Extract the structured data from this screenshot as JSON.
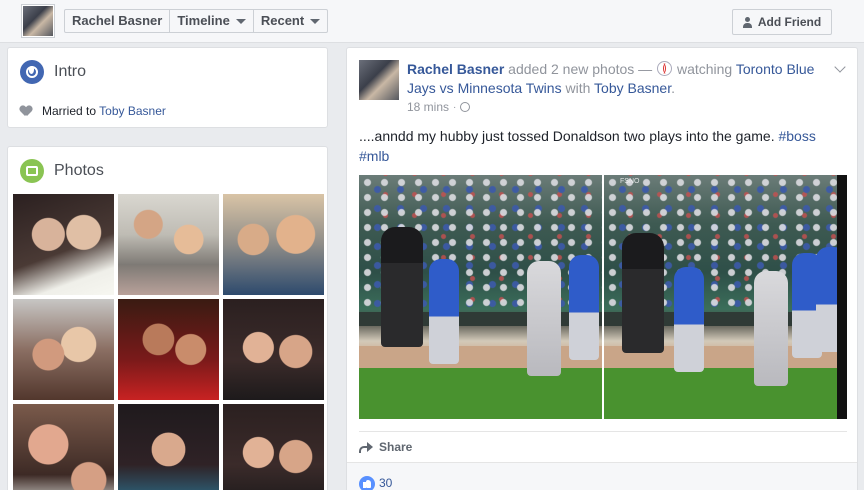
{
  "topbar": {
    "crumbs": [
      {
        "label": "Rachel Basner"
      },
      {
        "label": "Timeline"
      },
      {
        "label": "Recent"
      }
    ],
    "add_friend_label": "Add Friend"
  },
  "intro": {
    "title": "Intro",
    "married_prefix": "Married to",
    "spouse": "Toby Basner"
  },
  "photos": {
    "title": "Photos",
    "count": 9
  },
  "post": {
    "author": "Rachel Basner",
    "action": "added 2 new photos —",
    "activity": "watching",
    "event": "Toronto Blue Jays vs Minnesota Twins",
    "with_word": "with",
    "with_person": "Toby Basner",
    "end_punct": ".",
    "time": "18 mins",
    "text": "....anndd my hubby just tossed Donaldson two plays into the game.",
    "hashtag1": "#boss",
    "hashtag2": "#mlb",
    "photo_b_stamp": "FSNO",
    "share_label": "Share",
    "like_count": "30"
  },
  "colors": {
    "link": "#365899",
    "like_badge": "#5890ff",
    "intro_icon": "#4267b2",
    "photos_icon": "#8ac453"
  },
  "icons": [
    "profile-avatar",
    "caret-down-icon",
    "add-friend-icon",
    "globe-icon",
    "heart-icon",
    "photo-icon",
    "baseball-icon",
    "globe-small-icon",
    "chevron-down-icon",
    "share-icon",
    "like-icon"
  ]
}
